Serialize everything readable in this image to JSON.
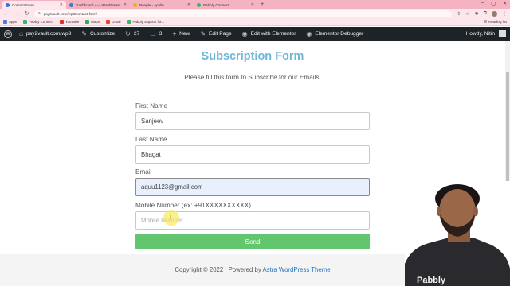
{
  "browser": {
    "tabs": [
      {
        "title": "Contact Form",
        "favicon_color": "#3b6fd6",
        "active": true
      },
      {
        "title": "Dashboard ‹ — WordPress",
        "favicon_color": "#3f78c4",
        "active": false
      },
      {
        "title": "People - Apollo",
        "favicon_color": "#e8b400",
        "active": false
      },
      {
        "title": "Pabbly Connect",
        "favicon_color": "#3bb56a",
        "active": false
      }
    ],
    "new_tab_label": "+",
    "address": "pay2vault.com/wp3/contact-form/",
    "bookmarks": [
      {
        "label": "Apps",
        "color": "#4a7be0"
      },
      {
        "label": "Pabbly Connect",
        "color": "#3bb56a"
      },
      {
        "label": "YouTube",
        "color": "#e52d27"
      },
      {
        "label": "Maps",
        "color": "#34a853"
      },
      {
        "label": "Gmail",
        "color": "#ea4335"
      },
      {
        "label": "Pabbly Support for...",
        "color": "#3bb56a"
      }
    ],
    "reading_list": "Reading list"
  },
  "adminbar": {
    "site": "pay2vault.com/wp3",
    "customize": "Customize",
    "updates": "27",
    "comments": "3",
    "new": "New",
    "edit_page": "Edit Page",
    "edit_elementor": "Edit with Elementor",
    "debugger": "Elementor Debugger",
    "howdy": "Howdy, Nitin"
  },
  "form": {
    "title": "Subscription Form",
    "subtitle": "Please fill this form to Subscribe for our Emails.",
    "first_name_label": "First Name",
    "first_name_value": "Sanjeev",
    "last_name_label": "Last Name",
    "last_name_value": "Bhagat",
    "email_label": "Email",
    "email_value": "aquu1123@gmail.com",
    "mobile_label": "Mobile Number (ex: +91XXXXXXXXXX)",
    "mobile_placeholder": "Mobile Number",
    "send_label": "Send"
  },
  "footer": {
    "prefix": "Copyright © 2022 | Powered by ",
    "link": "Astra WordPress Theme"
  },
  "webcam": {
    "shirt_text": "Pabbly"
  },
  "colors": {
    "title": "#6fb7d6",
    "send_button": "#63c56e",
    "adminbar": "#1d2327",
    "tabstrip": "#f5b3c1"
  }
}
